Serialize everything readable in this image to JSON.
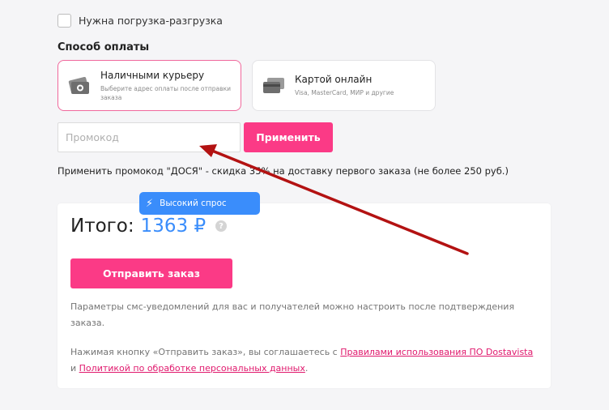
{
  "loading": {
    "label": "Нужна погрузка-разгрузка",
    "checked": false
  },
  "payment": {
    "title": "Способ оплаты",
    "options": [
      {
        "title": "Наличными курьеру",
        "subtitle": "Выберите адрес оплаты после отправки заказа",
        "icon": "cash-icon",
        "selected": true
      },
      {
        "title": "Картой онлайн",
        "subtitle": "Visa, MasterCard, МИР и другие",
        "icon": "card-icon",
        "selected": false
      }
    ]
  },
  "promo": {
    "placeholder": "Промокод",
    "value": "",
    "apply_label": "Применить",
    "note": "Применить промокод \"ДОСЯ\" - скидка 35% на доставку первого заказа (не более 250 руб.)"
  },
  "badge": {
    "icon": "lightning-icon",
    "label": "Высокий спрос"
  },
  "total": {
    "label": "Итого:",
    "value": "1363 ₽",
    "help_icon": "question-icon",
    "submit_label": "Отправить заказ",
    "note1": "Параметры смс-уведомлений для вас и получателей можно настроить после подтверждения заказа.",
    "note2_prefix": "Нажимая кнопку «Отправить заказ», вы соглашаетесь с ",
    "note2_link1": "Правилами использования ПО Dostavista",
    "note2_middle": " и ",
    "note2_link2": "Политикой по обработке персональных данных",
    "note2_suffix": "."
  },
  "colors": {
    "accent": "#fb3a86",
    "blue": "#3a8dfb",
    "annotation_arrow": "#b31212"
  }
}
